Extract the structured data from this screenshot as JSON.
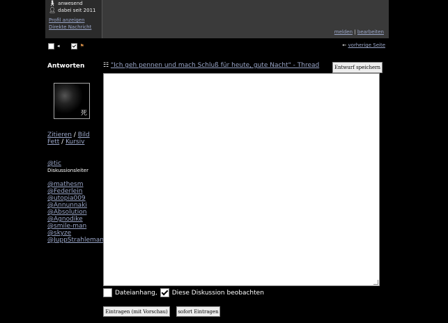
{
  "profile": {
    "status": "anwesend",
    "member_since": "dabei seit 2011",
    "show_profile": "Profil anzeigen",
    "direct_message": "Direkte Nachricht",
    "report": "melden",
    "edit": "bearbeiten",
    "link_separator": "|"
  },
  "nav": {
    "previous_page": "vorherige Seite"
  },
  "sidebar": {
    "title": "Antworten",
    "avatar_sign": "死",
    "format": {
      "quote": "Zitieren",
      "image": "Bild",
      "bold": "Fett",
      "italic": "Kursiv",
      "separator": "/"
    },
    "moderator": {
      "handle": "@tic",
      "role": "Diskussionsleiter"
    },
    "mentions": [
      "@mathesm",
      "@Federlein",
      "@utopia009",
      "@Annunnaki",
      "@Absolution",
      "@Agnodike",
      "@smile-man",
      "@skyze",
      "@JuppStrahleman"
    ]
  },
  "editor": {
    "thread_title": "\"Ich geh pennen und mach Schluß für heute, gute Nacht\" - Thread",
    "save_draft": "Entwurf speichern",
    "attachment_label": "Dateianhang,",
    "watch_label": "Diese Diskussion beobachten",
    "submit_preview": "Eintragen (mit Vorschau)",
    "submit_now": "sofort Eintragen"
  },
  "colors": {
    "background": "#000000",
    "link": "#9aa6c8",
    "panel": "#3a3a3a"
  }
}
